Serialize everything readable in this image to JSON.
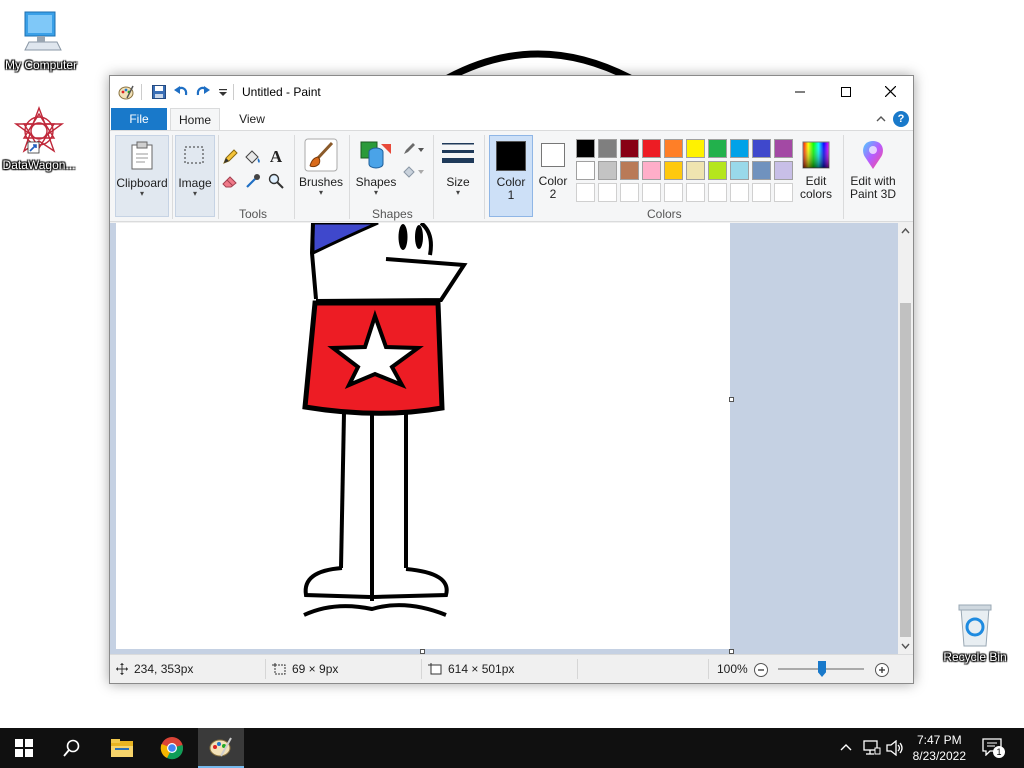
{
  "desktop": {
    "icons": [
      {
        "label": "My Computer"
      },
      {
        "label": "DataWagon..."
      },
      {
        "label": "Recycle Bin"
      }
    ]
  },
  "window": {
    "title": "Untitled - Paint",
    "tabs": {
      "file": "File",
      "home": "Home",
      "view": "View"
    },
    "help_label": "?"
  },
  "ribbon": {
    "clipboard": "Clipboard",
    "image": "Image",
    "tools_group": "Tools",
    "brushes": "Brushes",
    "shapes": "Shapes",
    "shapes_group": "Shapes",
    "size": "Size",
    "color1_line1": "Color",
    "color1_line2": "1",
    "color2_line1": "Color",
    "color2_line2": "2",
    "colors_group": "Colors",
    "edit_colors_line1": "Edit",
    "edit_colors_line2": "colors",
    "edit_3d_line1": "Edit with",
    "edit_3d_line2": "Paint 3D",
    "text_tool_glyph": "A"
  },
  "colors": {
    "color1": "#000000",
    "color2": "#ffffff",
    "palette_row1": [
      "#000000",
      "#7f7f7f",
      "#880015",
      "#ed1c24",
      "#ff7f27",
      "#fff200",
      "#22b14c",
      "#00a2e8",
      "#3f48cc",
      "#a349a4"
    ],
    "palette_row2": [
      "#ffffff",
      "#c3c3c3",
      "#b97a57",
      "#ffaec9",
      "#ffc90e",
      "#efe4b0",
      "#b5e61d",
      "#99d9ea",
      "#7092be",
      "#c8bfe7"
    ],
    "canvas_fill_red": "#ed1c24",
    "canvas_fill_blue": "#3f48cc"
  },
  "status": {
    "cursor_pos": "234, 353px",
    "selection_size": "69 × 9px",
    "canvas_size": "614 × 501px",
    "zoom": "100%"
  },
  "taskbar": {
    "time": "7:47 PM",
    "date": "8/23/2022",
    "notification_count": "1"
  }
}
